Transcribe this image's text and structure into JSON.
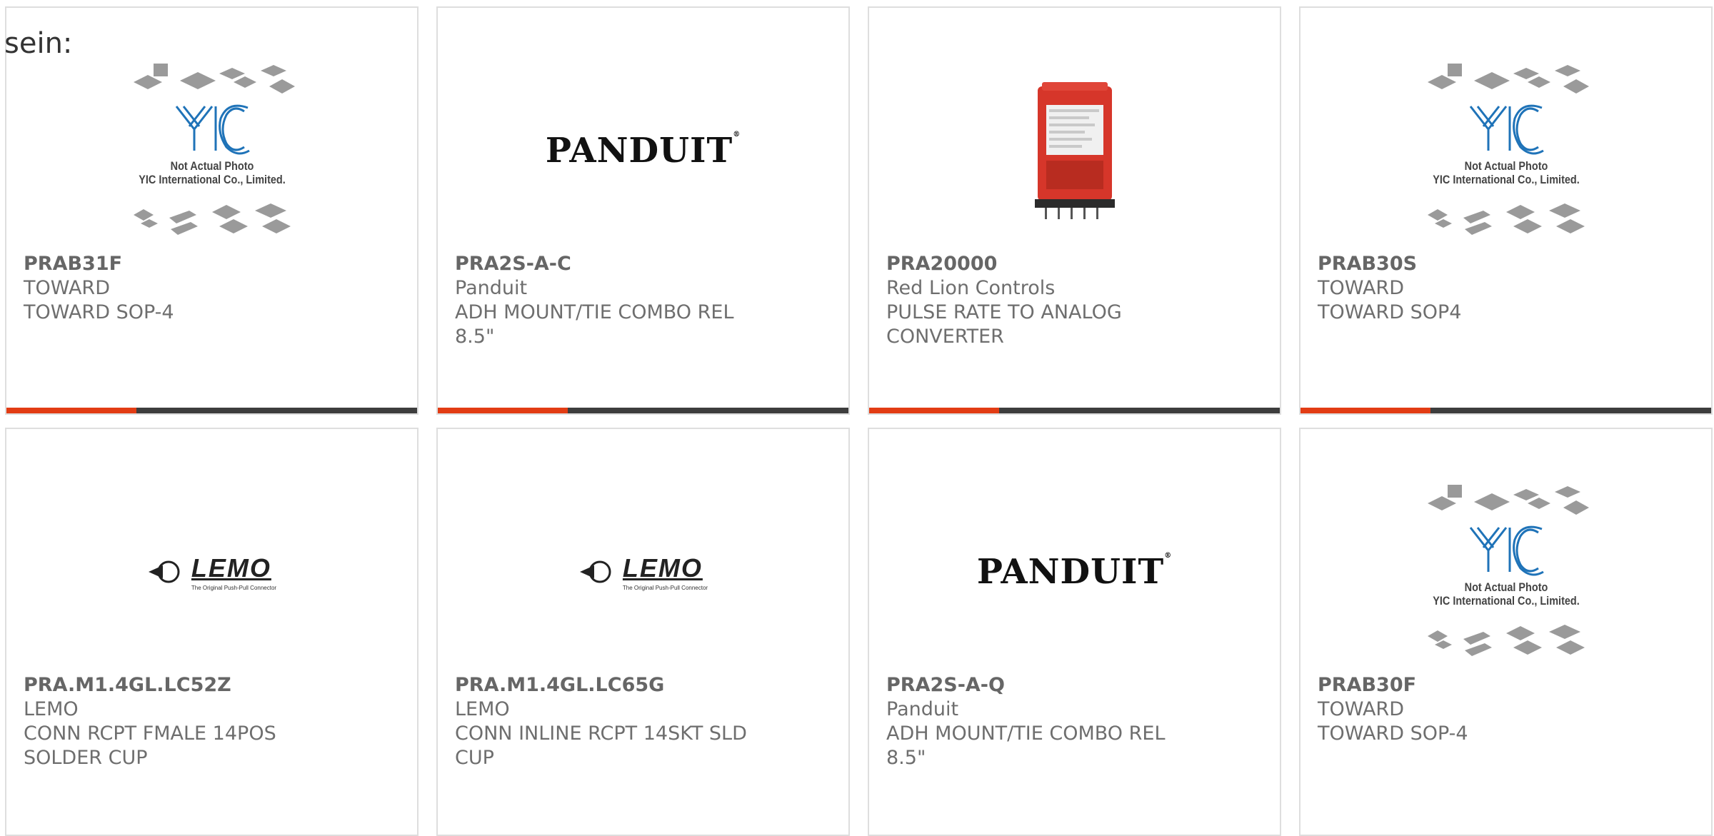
{
  "intro_text": "sein:",
  "products": [
    {
      "part_number": "PRAB31F",
      "manufacturer": "TOWARD",
      "description": "TOWARD SOP-4",
      "image": "yic-placeholder",
      "image_caption_1": "Not Actual Photo",
      "image_caption_2": "YIC International Co., Limited."
    },
    {
      "part_number": "PRA2S-A-C",
      "manufacturer": "Panduit",
      "description": "ADH MOUNT/TIE COMBO REL 8.5\"",
      "image": "panduit-logo",
      "logo_text": "PANDUIT"
    },
    {
      "part_number": "PRA20000",
      "manufacturer": "Red Lion Controls",
      "description": "PULSE RATE TO ANALOG CONVERTER",
      "image": "red-module-photo"
    },
    {
      "part_number": "PRAB30S",
      "manufacturer": "TOWARD",
      "description": "TOWARD SOP4",
      "image": "yic-placeholder",
      "image_caption_1": "Not Actual Photo",
      "image_caption_2": "YIC International Co., Limited."
    },
    {
      "part_number": "PRA.M1.4GL.LC52Z",
      "manufacturer": "LEMO",
      "description": "CONN RCPT FMALE 14POS SOLDER CUP",
      "image": "lemo-logo",
      "logo_text": "LEMO",
      "logo_tagline": "The Original Push-Pull Connector"
    },
    {
      "part_number": "PRA.M1.4GL.LC65G",
      "manufacturer": "LEMO",
      "description": "CONN INLINE RCPT 14SKT SLD CUP",
      "image": "lemo-logo",
      "logo_text": "LEMO",
      "logo_tagline": "The Original Push-Pull Connector"
    },
    {
      "part_number": "PRA2S-A-Q",
      "manufacturer": "Panduit",
      "description": "ADH MOUNT/TIE COMBO REL 8.5\"",
      "image": "panduit-logo",
      "logo_text": "PANDUIT"
    },
    {
      "part_number": "PRAB30F",
      "manufacturer": "TOWARD",
      "description": "TOWARD SOP-4",
      "image": "yic-placeholder",
      "image_caption_1": "Not Actual Photo",
      "image_caption_2": "YIC International Co., Limited."
    }
  ],
  "colors": {
    "accent": "#e23c14",
    "bar": "#3d3d3d",
    "border": "#dedede"
  }
}
